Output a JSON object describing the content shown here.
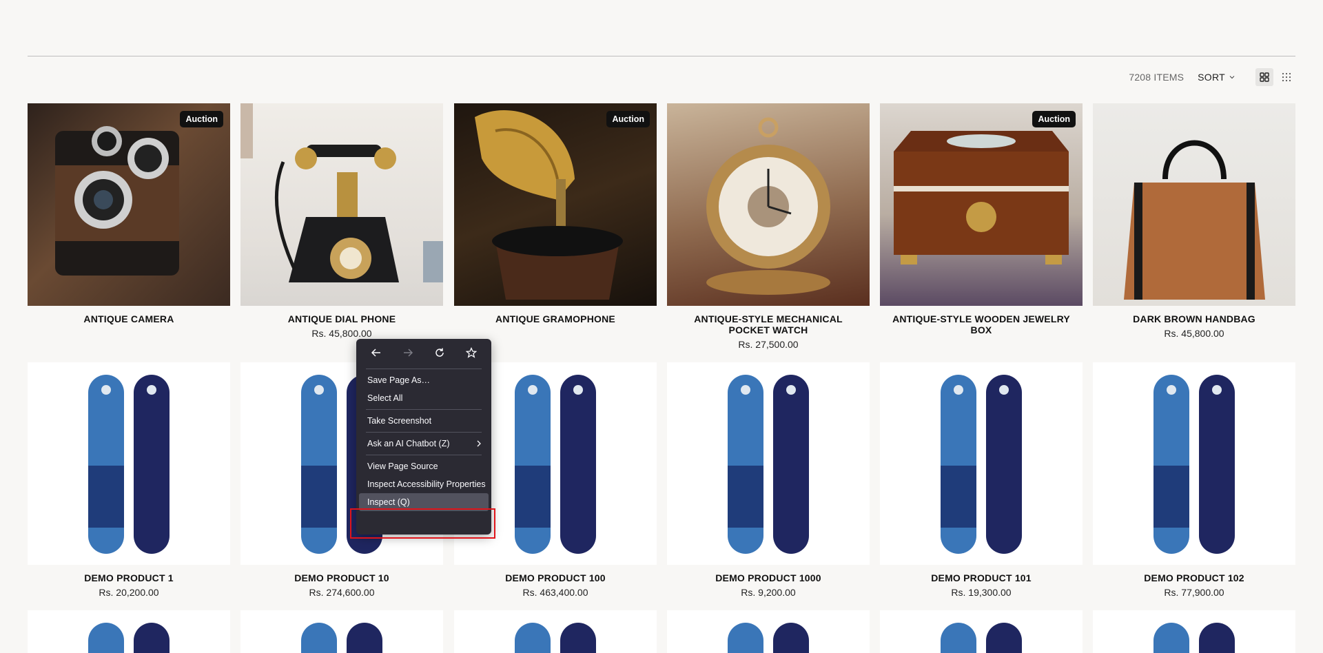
{
  "toolbar": {
    "items_count": "7208 ITEMS",
    "sort_label": "SORT",
    "view_grid_large": "grid-large-icon",
    "view_grid_small": "grid-small-icon"
  },
  "products": [
    {
      "title": "ANTIQUE CAMERA",
      "price": "",
      "badge": "Auction"
    },
    {
      "title": "ANTIQUE DIAL PHONE",
      "price": "Rs. 45,800.00",
      "badge": ""
    },
    {
      "title": "ANTIQUE GRAMOPHONE",
      "price": "",
      "badge": "Auction"
    },
    {
      "title": "ANTIQUE-STYLE MECHANICAL POCKET WATCH",
      "price": "Rs. 27,500.00",
      "badge": ""
    },
    {
      "title": "ANTIQUE-STYLE WOODEN JEWELRY BOX",
      "price": "",
      "badge": "Auction"
    },
    {
      "title": "DARK BROWN HANDBAG",
      "price": "Rs. 45,800.00",
      "badge": ""
    },
    {
      "title": "DEMO PRODUCT 1",
      "price": "Rs. 20,200.00",
      "badge": ""
    },
    {
      "title": "DEMO PRODUCT 10",
      "price": "Rs. 274,600.00",
      "badge": ""
    },
    {
      "title": "DEMO PRODUCT 100",
      "price": "Rs. 463,400.00",
      "badge": ""
    },
    {
      "title": "DEMO PRODUCT 1000",
      "price": "Rs. 9,200.00",
      "badge": ""
    },
    {
      "title": "DEMO PRODUCT 101",
      "price": "Rs. 19,300.00",
      "badge": ""
    },
    {
      "title": "DEMO PRODUCT 102",
      "price": "Rs. 77,900.00",
      "badge": ""
    }
  ],
  "context_menu": {
    "nav": [
      "back-icon",
      "forward-icon",
      "reload-icon",
      "bookmark-star-icon"
    ],
    "items": [
      "Save Page As…",
      "Select All",
      "Take Screenshot",
      "Ask an AI Chatbot (Z)",
      "View Page Source",
      "Inspect Accessibility Properties",
      "Inspect (Q)"
    ]
  }
}
